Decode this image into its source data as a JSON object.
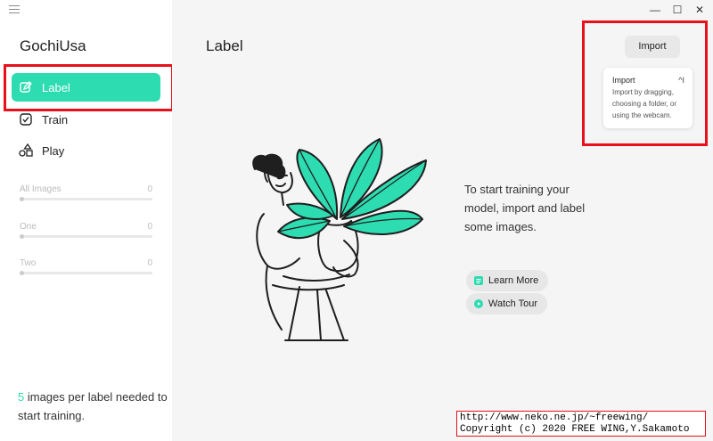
{
  "app": {
    "title": "GochiUsa"
  },
  "sidebar": {
    "nav": [
      {
        "label": "Label",
        "icon": "edit-square-icon",
        "active": true
      },
      {
        "label": "Train",
        "icon": "checkbox-icon",
        "active": false
      },
      {
        "label": "Play",
        "icon": "shapes-icon",
        "active": false
      }
    ],
    "labels": [
      {
        "name": "All Images",
        "count": "0",
        "progress": 0
      },
      {
        "name": "One",
        "count": "0",
        "progress": 0
      },
      {
        "name": "Two",
        "count": "0",
        "progress": 0
      }
    ],
    "footer": {
      "count": "5",
      "text": " images per label needed to start training."
    }
  },
  "main": {
    "title": "Label",
    "import_button": "Import",
    "tooltip": {
      "title": "Import",
      "shortcut": "^I",
      "body": "Import by dragging, choosing a folder, or using the webcam."
    },
    "cta": {
      "text": "To start training your model, import and label some images.",
      "learn_more": "Learn More",
      "watch_tour": "Watch Tour"
    }
  },
  "window": {
    "minimize": "—",
    "maximize": "☐",
    "close": "✕"
  },
  "copyright": {
    "line1": "http://www.neko.ne.jp/~freewing/",
    "line2": "Copyright (c) 2020 FREE WING,Y.Sakamoto"
  },
  "colors": {
    "accent": "#2ddcb1",
    "highlight_box": "#e8101a"
  }
}
